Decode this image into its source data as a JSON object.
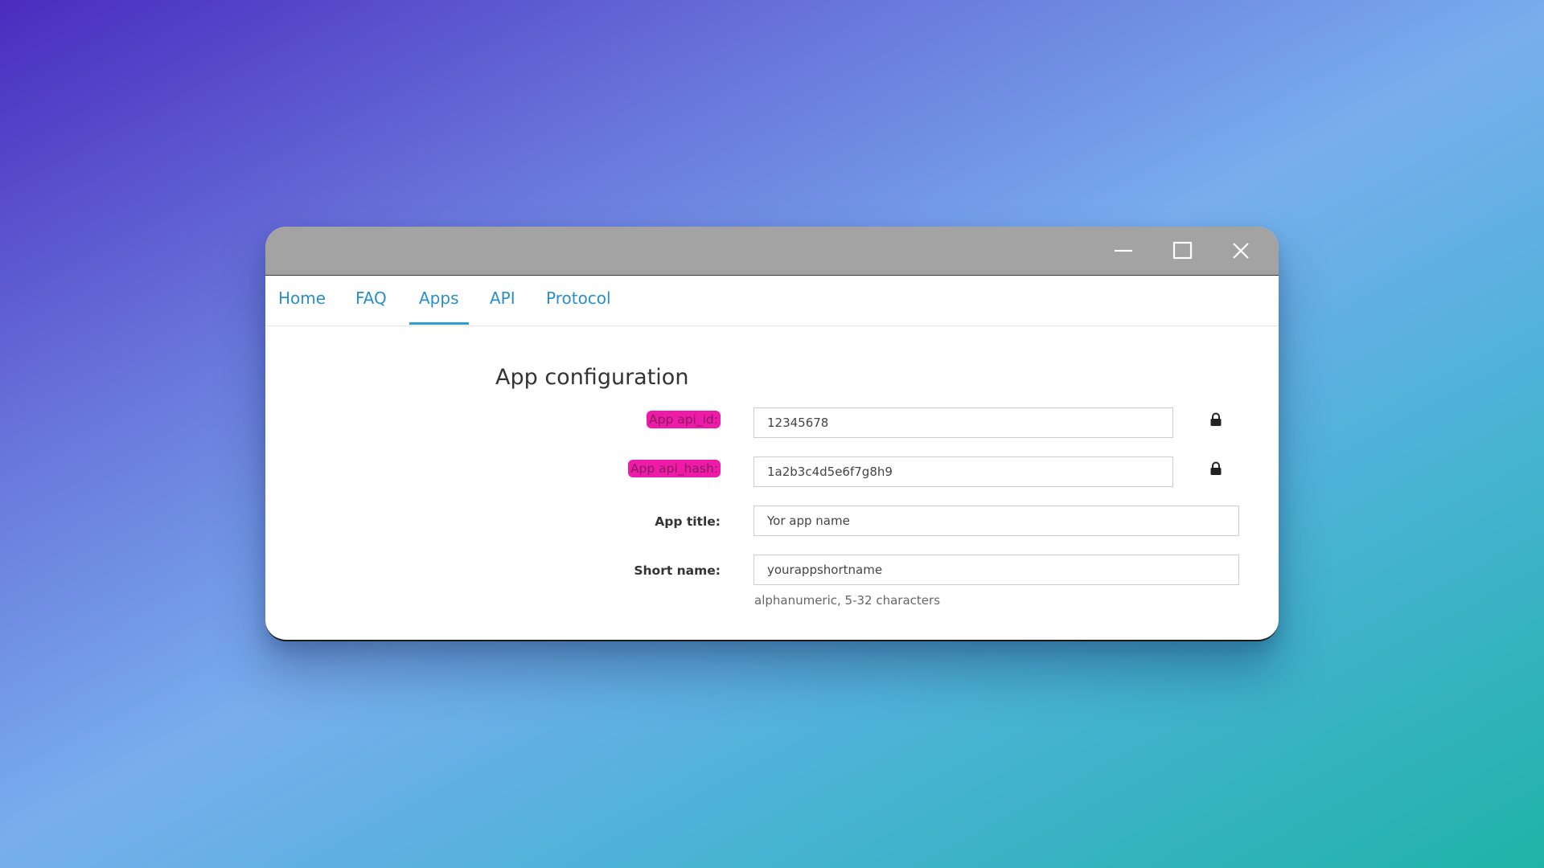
{
  "window": {
    "controls": {
      "minimize_icon": "minimize-icon",
      "maximize_icon": "maximize-icon",
      "close_icon": "close-icon"
    },
    "titlebar_color": "#a3a3a3"
  },
  "nav": {
    "tabs": [
      {
        "label": "Home"
      },
      {
        "label": "FAQ"
      },
      {
        "label": "Apps",
        "active": true
      },
      {
        "label": "API"
      },
      {
        "label": "Protocol"
      }
    ],
    "link_color": "#2a8fc4"
  },
  "main": {
    "heading": "App configuration",
    "fields": {
      "api_id": {
        "label": "App api_id:",
        "value": "12345678",
        "locked": true,
        "highlight_color": "#ee1aa8"
      },
      "api_hash": {
        "label": "App api_hash:",
        "value": "1a2b3c4d5e6f7g8h9",
        "locked": true,
        "highlight_color": "#ee1aa8"
      },
      "title": {
        "label": "App title:",
        "value": "Yor app name"
      },
      "short_name": {
        "label": "Short name:",
        "value": "yourappshortname",
        "hint": "alphanumeric, 5-32 characters"
      }
    }
  }
}
